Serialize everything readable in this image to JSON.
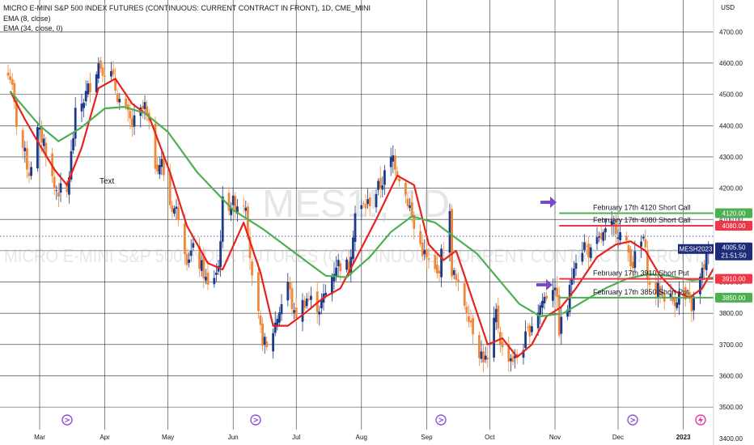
{
  "legend": {
    "title": "MICRO E-MINI S&P 500 INDEX FUTURES (CONTINUOUS: CURRENT CONTRACT IN FRONT), 1D, CME_MINI",
    "ema_fast": "EMA (8, close)",
    "ema_slow": "EMA (34, close, 0)"
  },
  "watermark": {
    "symbol": "MES1!, 1D",
    "name": "MICRO E-MINI S&P 500 INDEX FUTURES (CONTINUOUS: CURRENT CONTRACT IN FRONT)"
  },
  "annotation_text": "Text",
  "colors": {
    "bull": "#1e3a8a",
    "bear": "#f0883a",
    "ema_fast": "#e8211b",
    "ema_slow": "#4caf50",
    "arrow": "#7a48c8",
    "grid": "#2f2f2f",
    "price_tag_dark": "#1d2b7a"
  },
  "chart_data": {
    "type": "candlestick",
    "title": "MICRO E-MINI S&P 500 INDEX FUTURES (CONTINUOUS: CURRENT CONTRACT IN FRONT), 1D, CME_MINI",
    "currency": "USD",
    "ylim": [
      3400,
      4750
    ],
    "y_ticks": [
      3400,
      3500,
      3600,
      3700,
      3800,
      3900,
      4000,
      4100,
      4200,
      4300,
      4400,
      4500,
      4600,
      4700
    ],
    "y_tick_labels": [
      "3400.00",
      "3500.00",
      "3600.00",
      "3700.00",
      "3800.00",
      "3900.00",
      "4000.00",
      "4100.00",
      "4200.00",
      "4300.00",
      "4400.00",
      "4500.00",
      "4600.00",
      "4700.00"
    ],
    "x_range": [
      "2022-02-14",
      "2023-01-18"
    ],
    "x_ticks": [
      {
        "label": "Mar",
        "date": "2022-03-01"
      },
      {
        "label": "Apr",
        "date": "2022-04-01"
      },
      {
        "label": "May",
        "date": "2022-05-01"
      },
      {
        "label": "Jun",
        "date": "2022-06-01"
      },
      {
        "label": "Jul",
        "date": "2022-07-01"
      },
      {
        "label": "Aug",
        "date": "2022-08-01"
      },
      {
        "label": "Sep",
        "date": "2022-09-01"
      },
      {
        "label": "Oct",
        "date": "2022-10-01"
      },
      {
        "label": "Nov",
        "date": "2022-11-01"
      },
      {
        "label": "Dec",
        "date": "2022-12-01"
      },
      {
        "label": "2023",
        "date": "2023-01-01"
      }
    ],
    "close_path": [
      [
        "2022-02-15",
        4560
      ],
      [
        "2022-02-18",
        4410
      ],
      [
        "2022-02-24",
        4250
      ],
      [
        "2022-02-28",
        4380
      ],
      [
        "2022-03-03",
        4350
      ],
      [
        "2022-03-08",
        4200
      ],
      [
        "2022-03-14",
        4180
      ],
      [
        "2022-03-18",
        4430
      ],
      [
        "2022-03-23",
        4500
      ],
      [
        "2022-03-29",
        4600
      ],
      [
        "2022-04-04",
        4560
      ],
      [
        "2022-04-08",
        4480
      ],
      [
        "2022-04-14",
        4400
      ],
      [
        "2022-04-20",
        4460
      ],
      [
        "2022-04-25",
        4280
      ],
      [
        "2022-04-28",
        4280
      ],
      [
        "2022-05-02",
        4150
      ],
      [
        "2022-05-06",
        4120
      ],
      [
        "2022-05-10",
        3980
      ],
      [
        "2022-05-13",
        4000
      ],
      [
        "2022-05-18",
        3930
      ],
      [
        "2022-05-20",
        3880
      ],
      [
        "2022-05-25",
        3950
      ],
      [
        "2022-05-27",
        4150
      ],
      [
        "2022-06-02",
        4150
      ],
      [
        "2022-06-07",
        4160
      ],
      [
        "2022-06-10",
        3900
      ],
      [
        "2022-06-14",
        3740
      ],
      [
        "2022-06-17",
        3680
      ],
      [
        "2022-06-22",
        3790
      ],
      [
        "2022-06-27",
        3900
      ],
      [
        "2022-06-30",
        3790
      ],
      [
        "2022-07-06",
        3850
      ],
      [
        "2022-07-12",
        3820
      ],
      [
        "2022-07-15",
        3860
      ],
      [
        "2022-07-20",
        3960
      ],
      [
        "2022-07-26",
        3950
      ],
      [
        "2022-07-29",
        4120
      ],
      [
        "2022-08-04",
        4150
      ],
      [
        "2022-08-10",
        4210
      ],
      [
        "2022-08-16",
        4300
      ],
      [
        "2022-08-19",
        4240
      ],
      [
        "2022-08-24",
        4140
      ],
      [
        "2022-08-26",
        4070
      ],
      [
        "2022-09-01",
        3970
      ],
      [
        "2022-09-06",
        3920
      ],
      [
        "2022-09-12",
        4110
      ],
      [
        "2022-09-13",
        3940
      ],
      [
        "2022-09-16",
        3880
      ],
      [
        "2022-09-21",
        3800
      ],
      [
        "2022-09-26",
        3680
      ],
      [
        "2022-09-30",
        3640
      ],
      [
        "2022-10-04",
        3800
      ],
      [
        "2022-10-07",
        3680
      ],
      [
        "2022-10-13",
        3650
      ],
      [
        "2022-10-17",
        3700
      ],
      [
        "2022-10-21",
        3770
      ],
      [
        "2022-10-26",
        3840
      ],
      [
        "2022-11-01",
        3900
      ],
      [
        "2022-11-03",
        3750
      ],
      [
        "2022-11-07",
        3820
      ],
      [
        "2022-11-10",
        3970
      ],
      [
        "2022-11-15",
        4020
      ],
      [
        "2022-11-18",
        3990
      ],
      [
        "2022-11-23",
        4040
      ],
      [
        "2022-11-30",
        4080
      ],
      [
        "2022-12-05",
        4010
      ],
      [
        "2022-12-08",
        3960
      ],
      [
        "2022-12-13",
        4040
      ],
      [
        "2022-12-16",
        3880
      ],
      [
        "2022-12-21",
        3870
      ],
      [
        "2022-12-27",
        3840
      ],
      [
        "2022-12-30",
        3860
      ],
      [
        "2023-01-05",
        3820
      ],
      [
        "2023-01-10",
        3930
      ],
      [
        "2023-01-13",
        4000
      ]
    ],
    "series": [
      {
        "name": "EMA (8, close)",
        "points": [
          [
            "2022-02-15",
            4510
          ],
          [
            "2022-02-22",
            4420
          ],
          [
            "2022-02-28",
            4350
          ],
          [
            "2022-03-08",
            4260
          ],
          [
            "2022-03-14",
            4210
          ],
          [
            "2022-03-21",
            4330
          ],
          [
            "2022-03-29",
            4520
          ],
          [
            "2022-04-06",
            4550
          ],
          [
            "2022-04-14",
            4470
          ],
          [
            "2022-04-22",
            4430
          ],
          [
            "2022-05-02",
            4250
          ],
          [
            "2022-05-10",
            4080
          ],
          [
            "2022-05-20",
            3960
          ],
          [
            "2022-05-27",
            3940
          ],
          [
            "2022-06-06",
            4090
          ],
          [
            "2022-06-14",
            3930
          ],
          [
            "2022-06-20",
            3760
          ],
          [
            "2022-06-27",
            3760
          ],
          [
            "2022-07-05",
            3800
          ],
          [
            "2022-07-14",
            3850
          ],
          [
            "2022-07-22",
            3880
          ],
          [
            "2022-07-29",
            3970
          ],
          [
            "2022-08-08",
            4100
          ],
          [
            "2022-08-18",
            4240
          ],
          [
            "2022-08-26",
            4210
          ],
          [
            "2022-09-02",
            4020
          ],
          [
            "2022-09-09",
            3970
          ],
          [
            "2022-09-15",
            4000
          ],
          [
            "2022-09-23",
            3840
          ],
          [
            "2022-09-30",
            3700
          ],
          [
            "2022-10-07",
            3720
          ],
          [
            "2022-10-14",
            3660
          ],
          [
            "2022-10-21",
            3700
          ],
          [
            "2022-10-28",
            3790
          ],
          [
            "2022-11-04",
            3820
          ],
          [
            "2022-11-11",
            3880
          ],
          [
            "2022-11-21",
            3980
          ],
          [
            "2022-11-30",
            4020
          ],
          [
            "2022-12-07",
            4030
          ],
          [
            "2022-12-14",
            4000
          ],
          [
            "2022-12-21",
            3920
          ],
          [
            "2022-12-28",
            3870
          ],
          [
            "2023-01-04",
            3850
          ],
          [
            "2023-01-10",
            3880
          ],
          [
            "2023-01-16",
            3950
          ]
        ]
      },
      {
        "name": "EMA (34, close, 0)",
        "points": [
          [
            "2022-02-15",
            4510
          ],
          [
            "2022-03-01",
            4400
          ],
          [
            "2022-03-10",
            4350
          ],
          [
            "2022-03-20",
            4390
          ],
          [
            "2022-04-01",
            4455
          ],
          [
            "2022-04-10",
            4460
          ],
          [
            "2022-04-20",
            4440
          ],
          [
            "2022-05-01",
            4380
          ],
          [
            "2022-05-15",
            4250
          ],
          [
            "2022-06-01",
            4130
          ],
          [
            "2022-06-15",
            4070
          ],
          [
            "2022-07-01",
            3990
          ],
          [
            "2022-07-15",
            3920
          ],
          [
            "2022-07-25",
            3915
          ],
          [
            "2022-08-05",
            3980
          ],
          [
            "2022-08-15",
            4060
          ],
          [
            "2022-08-25",
            4110
          ],
          [
            "2022-09-05",
            4090
          ],
          [
            "2022-09-15",
            4040
          ],
          [
            "2022-09-25",
            3990
          ],
          [
            "2022-10-05",
            3910
          ],
          [
            "2022-10-15",
            3830
          ],
          [
            "2022-10-25",
            3790
          ],
          [
            "2022-11-05",
            3800
          ],
          [
            "2022-11-15",
            3840
          ],
          [
            "2022-11-25",
            3880
          ],
          [
            "2022-12-05",
            3910
          ],
          [
            "2022-12-15",
            3925
          ],
          [
            "2022-12-25",
            3920
          ],
          [
            "2023-01-05",
            3905
          ],
          [
            "2023-01-16",
            3915
          ]
        ]
      }
    ],
    "annotations": {
      "lines": [
        {
          "label": "February 17th 4120 Short Call",
          "price": 4120,
          "price_label": "4120.00",
          "color": "#4caf50"
        },
        {
          "label": "February 17th 4080 Short Call",
          "price": 4080,
          "price_label": "4080.00",
          "color": "#f23645"
        },
        {
          "label": "February 17th 3910 Short Put",
          "price": 3910,
          "price_label": "3910.00",
          "color": "#f23645"
        },
        {
          "label": "February 17th 3850 Short Put",
          "price": 3850,
          "price_label": "3850.00",
          "color": "#4caf50"
        }
      ],
      "current_price": {
        "symbol": "MESH2023",
        "price": 4005.5,
        "price_label": "4005.50",
        "time_label": "21:51:50"
      }
    }
  }
}
